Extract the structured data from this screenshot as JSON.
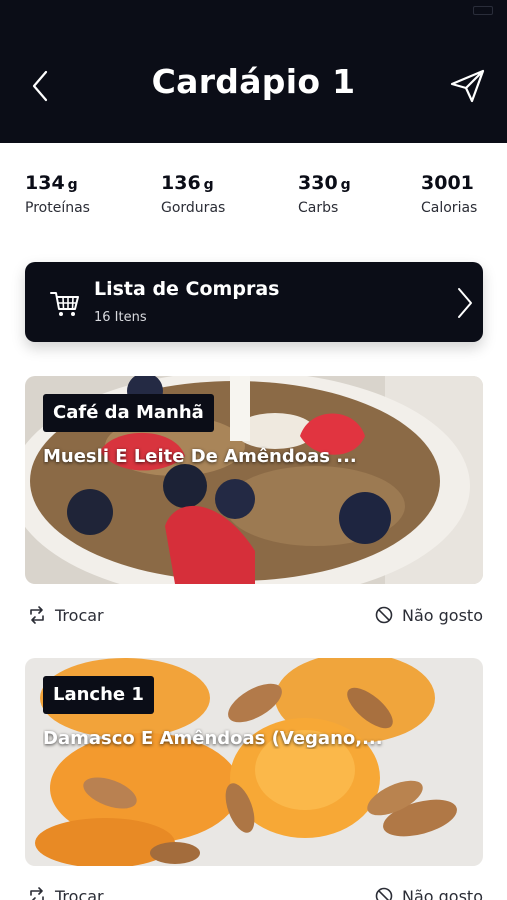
{
  "header": {
    "title": "Cardápio 1"
  },
  "macros": [
    {
      "value": "134",
      "unit": "g",
      "label": "Proteínas"
    },
    {
      "value": "136",
      "unit": "g",
      "label": "Gorduras"
    },
    {
      "value": "330",
      "unit": "g",
      "label": "Carbs"
    },
    {
      "value": "3001",
      "unit": "",
      "label": "Calorias"
    }
  ],
  "shopping": {
    "title": "Lista de Compras",
    "count": "16 Itens"
  },
  "meals": [
    {
      "badge": "Café da Manhã",
      "title": "Muesli E Leite De Amêndoas ...",
      "swap_label": "Trocar",
      "dislike_label": "Não gosto"
    },
    {
      "badge": "Lanche 1",
      "title": "Damasco E Amêndoas (Vegano,...",
      "swap_label": "Trocar",
      "dislike_label": "Não gosto"
    }
  ],
  "colors": {
    "primary": "#0b0d17",
    "background": "#ffffff",
    "text_muted": "#2b2d36"
  },
  "icons": {
    "back": "chevron-left-icon",
    "share": "send-icon",
    "cart": "cart-icon",
    "forward": "chevron-right-icon",
    "swap": "swap-icon",
    "dislike": "block-icon"
  }
}
